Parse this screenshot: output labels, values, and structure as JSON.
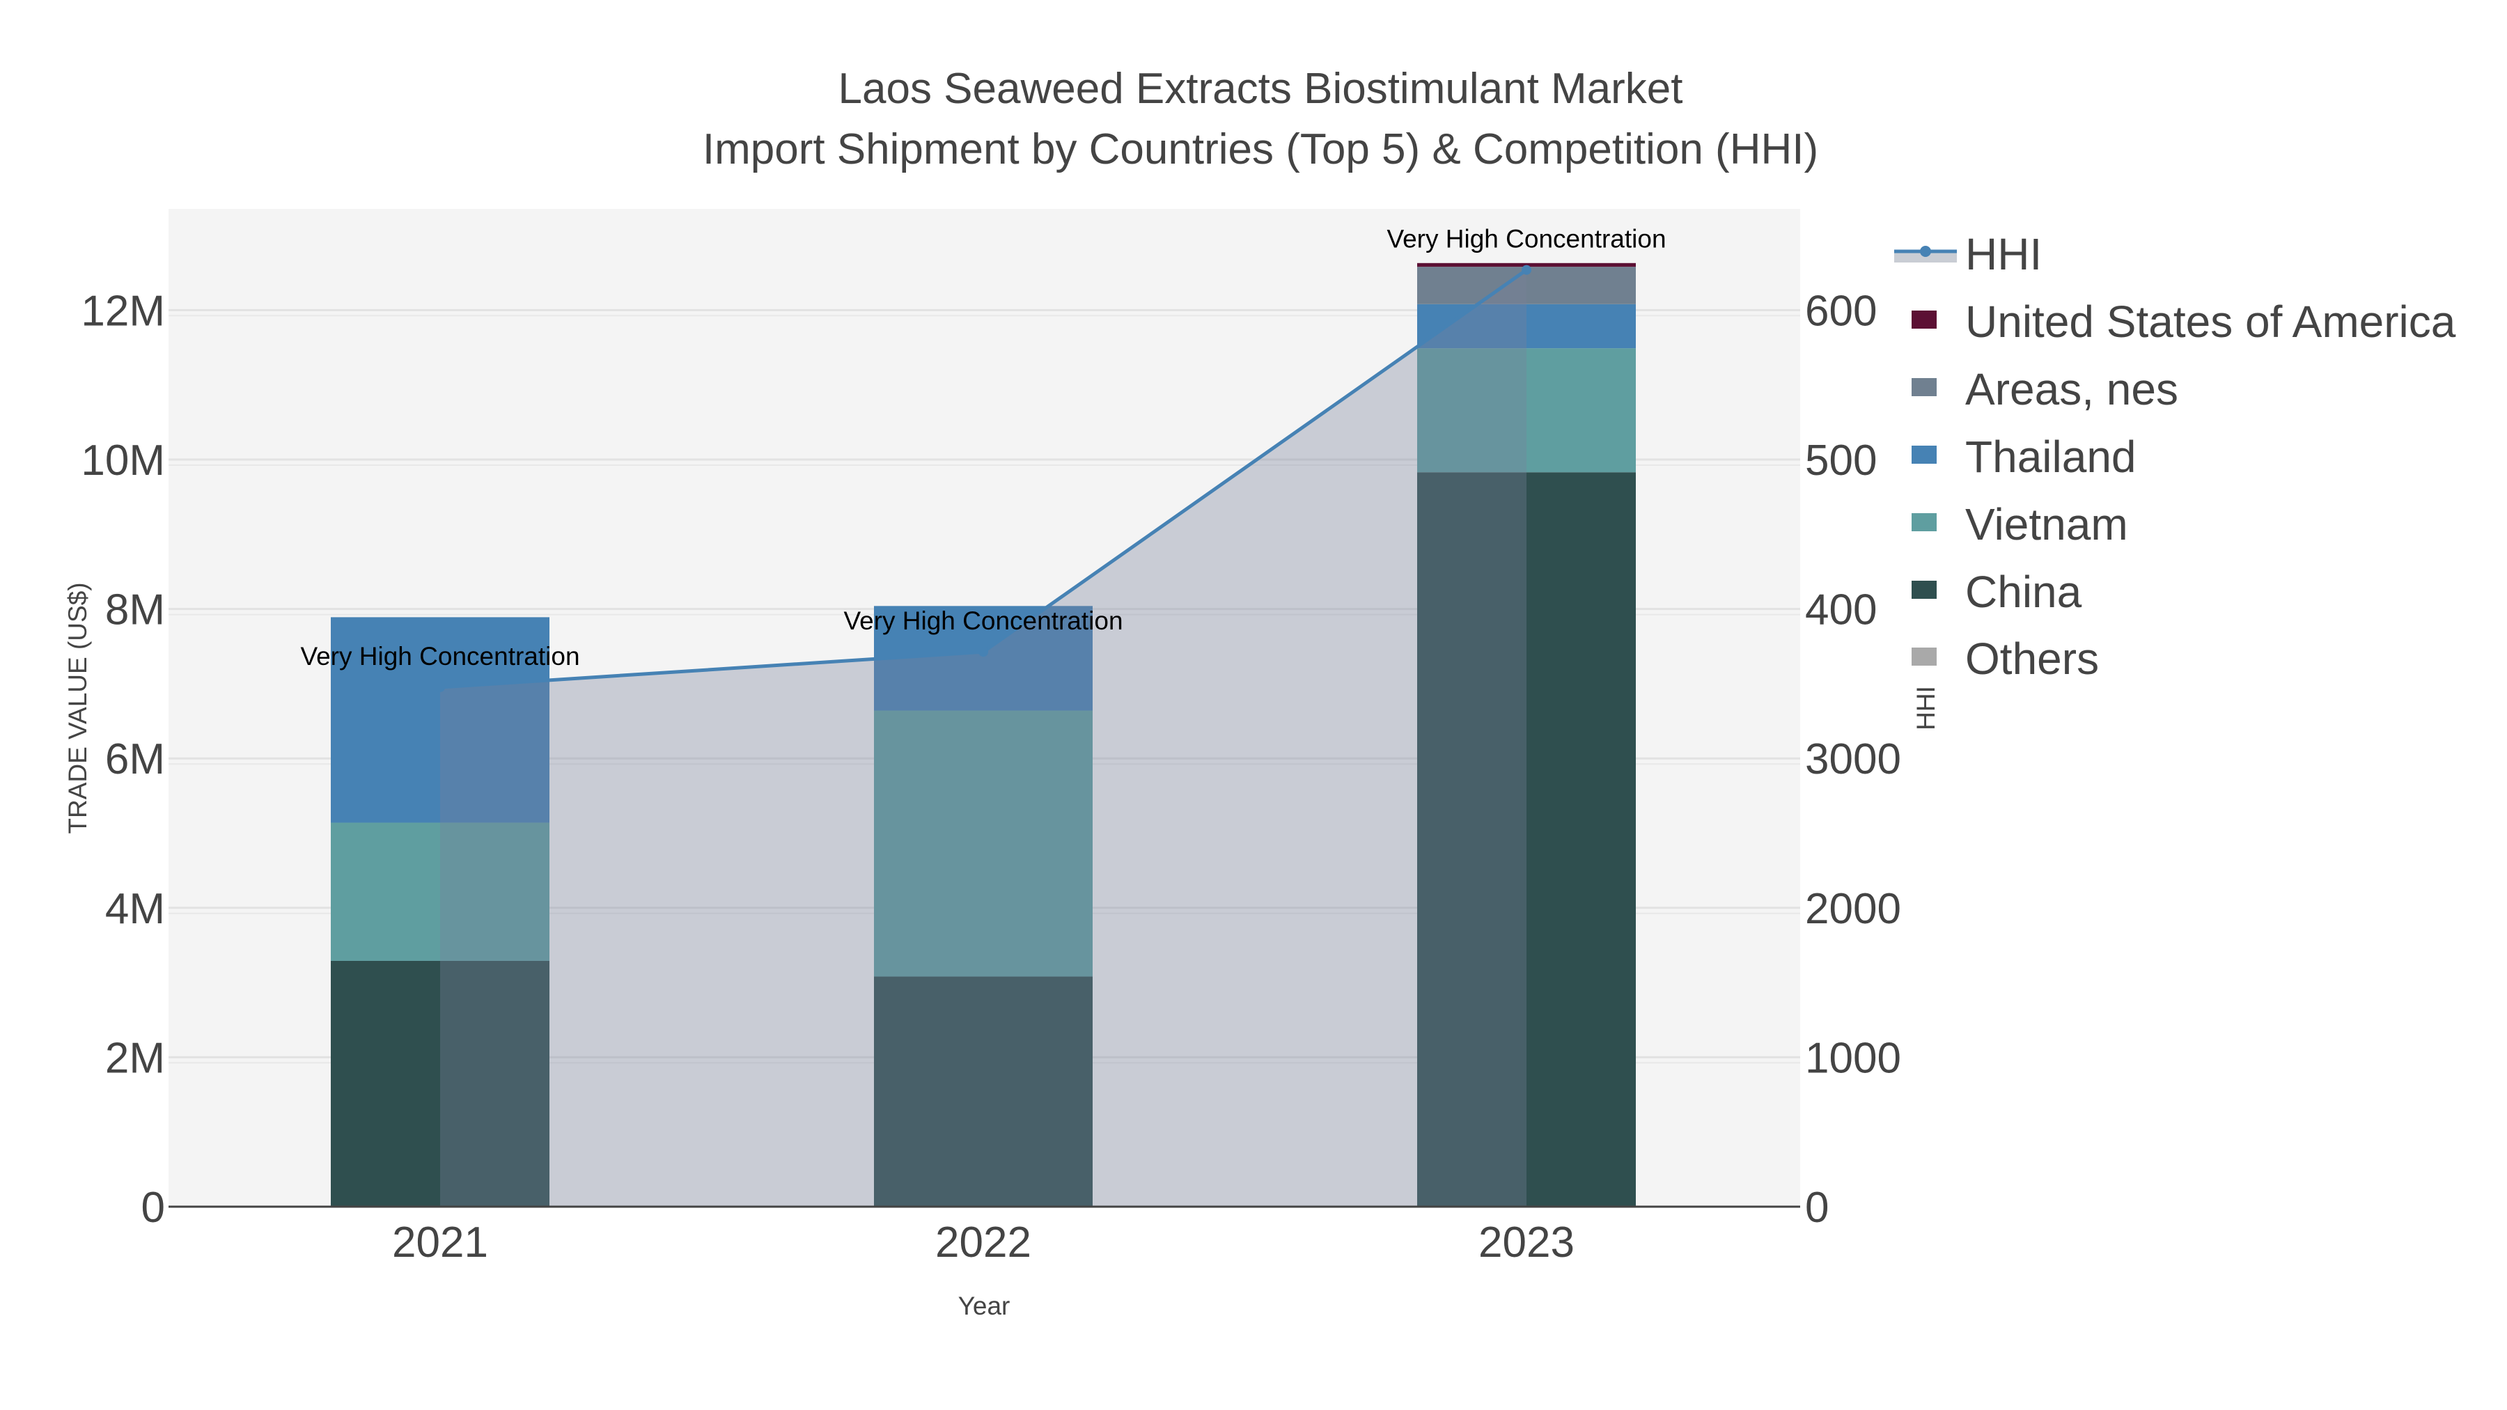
{
  "chart_data": {
    "type": "bar",
    "title": [
      "Laos Seaweed Extracts Biostimulant Market",
      "Import Shipment by Countries (Top 5) & Competition (HHI)"
    ],
    "xlabel": "Year",
    "ylabel": "TRADE VALUE (US$)",
    "y2label": "HHI",
    "categories": [
      "2021",
      "2022",
      "2023"
    ],
    "ylim": [
      0,
      13400000
    ],
    "y_ticks": [
      {
        "v": 0,
        "label": "0"
      },
      {
        "v": 2000000,
        "label": "2M"
      },
      {
        "v": 4000000,
        "label": "4M"
      },
      {
        "v": 6000000,
        "label": "6M"
      },
      {
        "v": 8000000,
        "label": "8M"
      },
      {
        "v": 10000000,
        "label": "10M"
      },
      {
        "v": 12000000,
        "label": "12M"
      }
    ],
    "y2lim": [
      0,
      6700
    ],
    "y2_ticks": [
      {
        "v": 0,
        "label": "0"
      },
      {
        "v": 1000,
        "label": "1000"
      },
      {
        "v": 2000,
        "label": "2000"
      },
      {
        "v": 3000,
        "label": "3000"
      },
      {
        "v": 4000,
        "label": "400"
      },
      {
        "v": 5000,
        "label": "500"
      },
      {
        "v": 6000,
        "label": "600"
      }
    ],
    "series": [
      {
        "name": "China",
        "color": "#2F4F4F",
        "values": [
          3290000,
          3080000,
          9830000
        ]
      },
      {
        "name": "Vietnam",
        "color": "#5F9EA0",
        "values": [
          1850000,
          3560000,
          1660000
        ]
      },
      {
        "name": "Thailand",
        "color": "#4682B4",
        "values": [
          2750000,
          1400000,
          590000
        ]
      },
      {
        "name": "Areas, nes",
        "color": "#708090",
        "values": [
          0,
          0,
          500000
        ]
      },
      {
        "name": "United States of America",
        "color": "#5C1034",
        "values": [
          0,
          0,
          50000
        ]
      },
      {
        "name": "Others",
        "color": "#A9A9A9",
        "values": [
          0,
          0,
          0
        ]
      }
    ],
    "hhi": {
      "name": "HHI",
      "color": "#4682B4",
      "values": [
        3476,
        3713,
        6269
      ]
    },
    "annotations": [
      "Very High Concentration",
      "Very High Concentration",
      "Very High Concentration"
    ],
    "legend": [
      "HHI",
      "United States of America",
      "Areas, nes",
      "Thailand",
      "Vietnam",
      "China",
      "Others"
    ],
    "legend_position": "right",
    "grid": true
  }
}
